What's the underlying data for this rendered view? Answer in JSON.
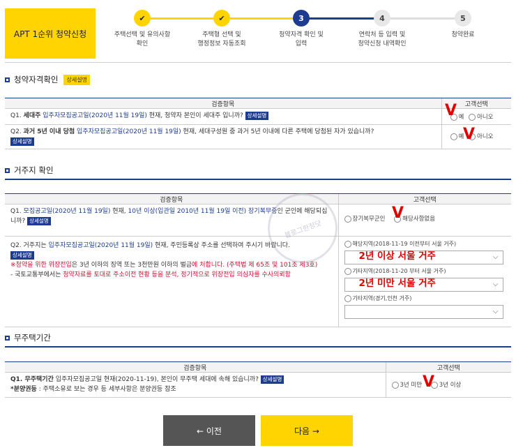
{
  "header": {
    "title": "APT 1순위 청약신청",
    "steps": [
      {
        "num": "✔",
        "label1": "주택선택 및 유의사항",
        "label2": "확인"
      },
      {
        "num": "✔",
        "label1": "주택형 선택 및",
        "label2": "행정정보 자동조회"
      },
      {
        "num": "3",
        "label1": "청약자격 확인 및",
        "label2": "입력"
      },
      {
        "num": "4",
        "label1": "연락처 등 입력 및",
        "label2": "청약신청 내역확인"
      },
      {
        "num": "5",
        "label1": "청약완료",
        "label2": ""
      }
    ]
  },
  "colors": {
    "accent": "#1d3c8f",
    "yellow": "#ffd400",
    "red": "#c8102e"
  },
  "sections": {
    "qualify": {
      "title": "청약자격확인",
      "badge": "상세설명",
      "col1": "검증항목",
      "col2": "고객선택",
      "q1": {
        "prefix": "Q1. ",
        "bold": "세대주",
        "link": "입주자모집공고일(2020년 11월 19일)",
        "rest": " 현재, 청약자 본인이 세대주 입니까?",
        "tag": "상세설명",
        "yes": "예",
        "no": "아니오"
      },
      "q2": {
        "prefix": "Q2. ",
        "bold": "과거 5년 이내 당첨",
        "link": "입주자모집공고일(2020년 11월 19일)",
        "rest": " 현재, 세대구성원 중 과거 5년 이내에 다른 주택에 당첨된 자가 있습니까?",
        "tag": "상세설명",
        "yes": "예",
        "no": "아니오"
      }
    },
    "residence": {
      "title": "거주지 확인",
      "col1": "검증항목",
      "col2": "고객선택",
      "q1": {
        "prefix": "Q1. ",
        "link": "모집공고일(2020년 11월 19일)",
        "mid": " 현재, ",
        "link2": "10년 이상(입관일 2010년 11월 19일 이전) 장기복무중",
        "rest": "인 군인에 해당되십니까?",
        "tag": "상세설명",
        "opt1": "장기복무군인",
        "opt2": "해당사항없음"
      },
      "q2": {
        "prefix": "Q2. 거주지는 ",
        "link": "입주자모집공고일(2020년 11월 19일)",
        "rest": " 현재, 주민등록상 주소를 선택하여 주시기 바랍니다.",
        "tag": "상세설명",
        "note1a": "※",
        "note1b": "청약을 위한 위장전입",
        "note1c": "은 3년 이하의 징역 또는 3천만원 이하의 벌금",
        "note1d": "에 처합니다. (주택법 제 65조 및 101조 제3호)",
        "note2a": "- 국토교통부에서는 ",
        "note2b": "청약자료를 토대로 주소이전 현황 등을 분석, 정기적으로 위장전입 의심자를 수사의뢰함"
      },
      "regions": [
        {
          "label": "해당지역(2018-11-19 이전부터 서울 거주)",
          "annotation": "2년 이상 서울 거주"
        },
        {
          "label": "기타지역(2018-11-20 부터 서울 거주)",
          "annotation": "2년 미만 서울 거주"
        },
        {
          "label": "기타지역(경기,인천 거주)",
          "annotation": ""
        }
      ]
    },
    "nohouse": {
      "title": "무주택기간",
      "col1": "검증항목",
      "col2": "고객선택",
      "q1": {
        "prefix": "Q1. 무주택기간",
        "rest": " 입주자모집공고일 현재(2020-11-19), 본인이 무주택 세대에 속해 있습니까?",
        "tag": "상세설명",
        "sub_b": "*분양권등",
        "sub": " : 주택소유로 보는 경우 등 세부사항은 분양권등 참조",
        "opt1": "3년 미만",
        "opt2": "3년 이상"
      }
    }
  },
  "annotations": {
    "check_mark": "V"
  },
  "watermark": "블로그한정닷",
  "buttons": {
    "prev": "← 이전",
    "next": "다음 →"
  }
}
